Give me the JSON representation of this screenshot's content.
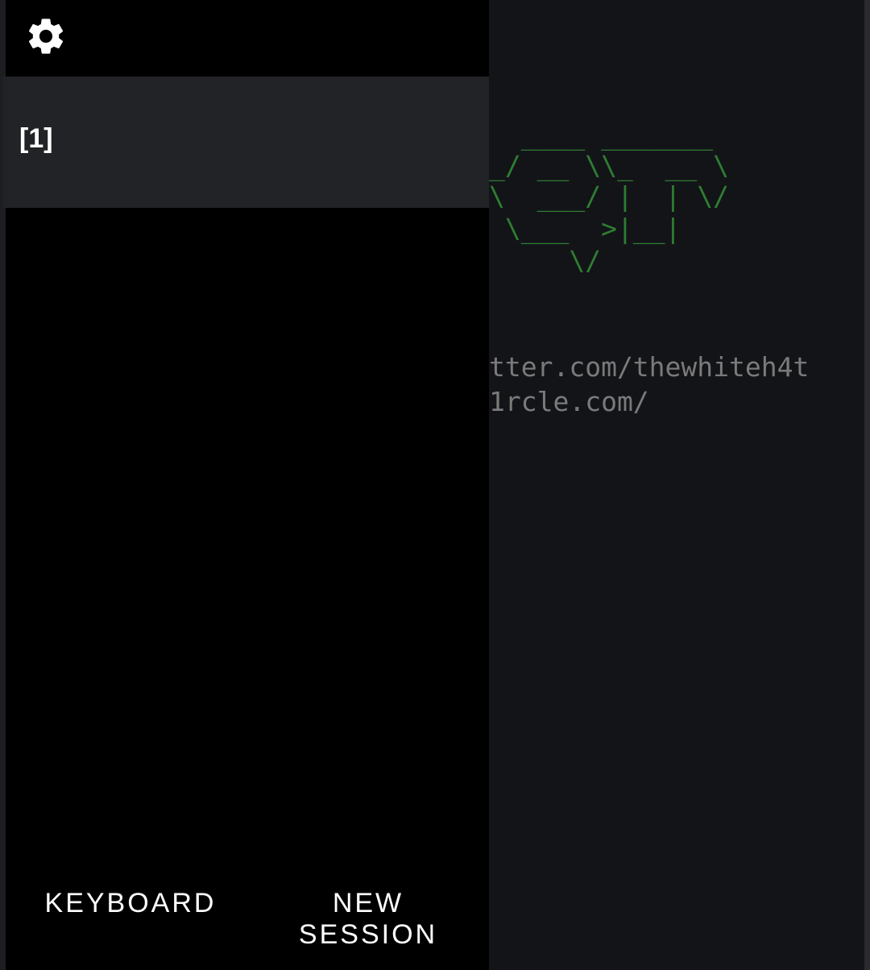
{
  "terminal": {
    "ascii_lines": [
      "  ____ _______",
      "_/ __ \\\\_  __ \\",
      "\\  ___/ |  | \\/",
      " \\___  >|__|",
      "     \\/"
    ],
    "link_lines": [
      "tter.com/thewhiteh4t",
      "1rcle.com/"
    ]
  },
  "drawer": {
    "settings_icon": "gear-icon",
    "sessions": [
      {
        "label": "[1]"
      }
    ],
    "keyboard_label": "KEYBOARD",
    "new_session_label_line1": "NEW",
    "new_session_label_line2": "SESSION"
  },
  "colors": {
    "terminal_bg": "#131418",
    "drawer_bg": "#000000",
    "session_bg": "#222327",
    "ascii_green": "#2e7d32",
    "link_gray": "#7a7a7a"
  }
}
